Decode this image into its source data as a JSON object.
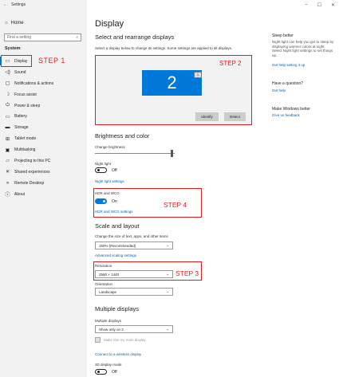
{
  "window": {
    "title": "Settings",
    "back": "←"
  },
  "sidebar": {
    "home": "Home",
    "search_placeholder": "Find a setting",
    "section": "System",
    "items": [
      {
        "label": "Display",
        "icon": "monitor-icon",
        "glyph": "▭"
      },
      {
        "label": "Sound",
        "icon": "speaker-icon",
        "glyph": "◁)"
      },
      {
        "label": "Notifications & actions",
        "icon": "notification-icon",
        "glyph": "▢"
      },
      {
        "label": "Focus assist",
        "icon": "moon-icon",
        "glyph": "☽"
      },
      {
        "label": "Power & sleep",
        "icon": "power-icon",
        "glyph": "⏻"
      },
      {
        "label": "Battery",
        "icon": "battery-icon",
        "glyph": "▭"
      },
      {
        "label": "Storage",
        "icon": "storage-icon",
        "glyph": "▬"
      },
      {
        "label": "Tablet mode",
        "icon": "tablet-icon",
        "glyph": "⊞"
      },
      {
        "label": "Multitasking",
        "icon": "multitask-icon",
        "glyph": "▣"
      },
      {
        "label": "Projecting to this PC",
        "icon": "project-icon",
        "glyph": "▱"
      },
      {
        "label": "Shared experiences",
        "icon": "shared-icon",
        "glyph": "✕"
      },
      {
        "label": "Remote Desktop",
        "icon": "remote-icon",
        "glyph": "»"
      },
      {
        "label": "About",
        "icon": "info-icon",
        "glyph": "ⓘ"
      }
    ]
  },
  "annotations": {
    "step1": "STEP 1",
    "step2": "STEP 2",
    "step3": "STEP 3",
    "step4": "STEP 4"
  },
  "main": {
    "title": "Display",
    "rearrange_heading": "Select and rearrange displays",
    "rearrange_desc": "Select a display below to change its settings. Some settings are applied to all displays.",
    "monitor_number": "2",
    "monitor2_label": "1",
    "identify": "Identify",
    "detect": "Detect",
    "brightness_heading": "Brightness and color",
    "change_brightness": "Change brightness",
    "night_light": "Night light",
    "night_light_state": "Off",
    "night_light_settings": "Night light settings",
    "hdr_label": "HDR and WCG",
    "hdr_state": "On",
    "hdr_settings": "HDR and WCG settings",
    "scale_heading": "Scale and layout",
    "scale_label": "Change the size of text, apps, and other items",
    "scale_value": "150% (Recommended)",
    "advanced_scaling": "Advanced scaling settings",
    "resolution_label": "Resolution",
    "resolution_value": "2560 × 1440",
    "orientation_label": "Orientation",
    "orientation_value": "Landscape",
    "multiple_heading": "Multiple displays",
    "multiple_label": "Multiple displays",
    "multiple_value": "Show only on 2",
    "main_display": "Make this my main display",
    "wireless": "Connect to a wireless display",
    "mode_3d": "3D display mode",
    "mode_3d_state": "Off"
  },
  "right": {
    "sleep_heading": "Sleep better",
    "sleep_text": "Night light can help you get to sleep by displaying warmer colors at night. Select Night light settings to set things up.",
    "sleep_link": "Get help setting it up",
    "question_heading": "Have a question?",
    "help_link": "Get help",
    "better_heading": "Make Windows better",
    "feedback_link": "Give us feedback"
  }
}
